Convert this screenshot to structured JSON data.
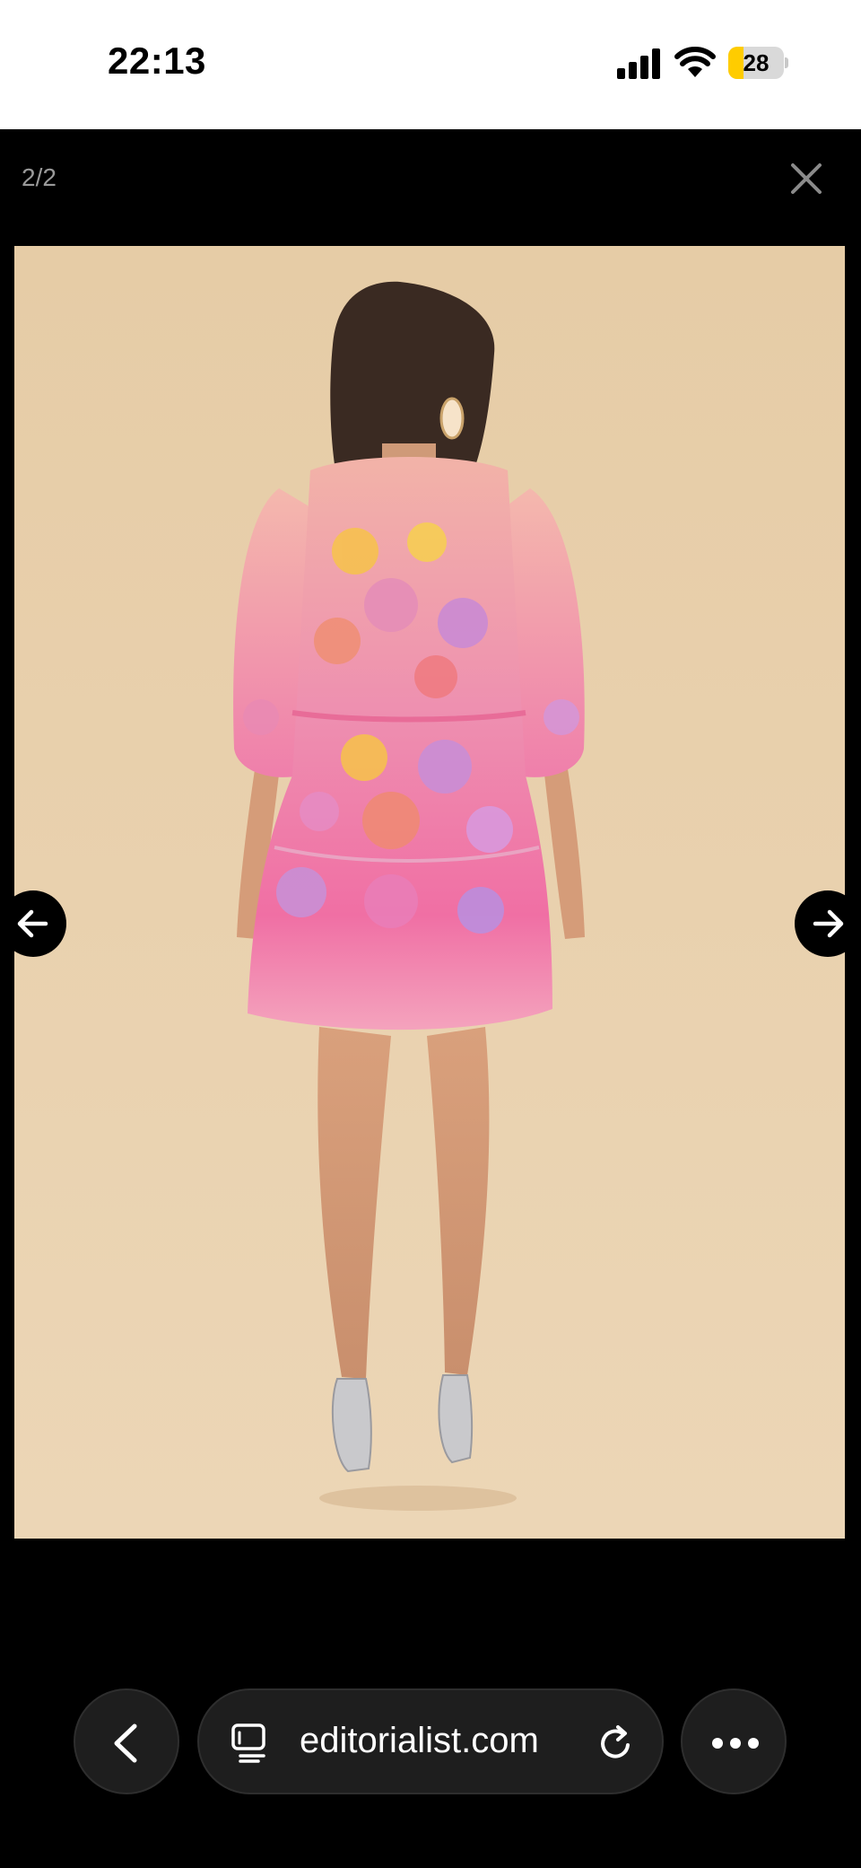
{
  "status_bar": {
    "time": "22:13",
    "battery": {
      "label": "28",
      "level_percent": 28,
      "color": "#ffcc00"
    },
    "icons": [
      "signal-icon",
      "wifi-icon",
      "battery-icon"
    ]
  },
  "viewer": {
    "counter": "2/2",
    "close_icon": "close-icon",
    "prev_icon": "arrow-left-icon",
    "next_icon": "arrow-right-icon"
  },
  "photo": {
    "subject": "model in pink floral mini dress, back view",
    "background_color": "#e8cfa9"
  },
  "browser": {
    "url": "editorialist.com",
    "back_icon": "chevron-left-icon",
    "tabs_icon": "tabs-icon",
    "reload_icon": "reload-icon",
    "more_icon": "more-icon"
  }
}
